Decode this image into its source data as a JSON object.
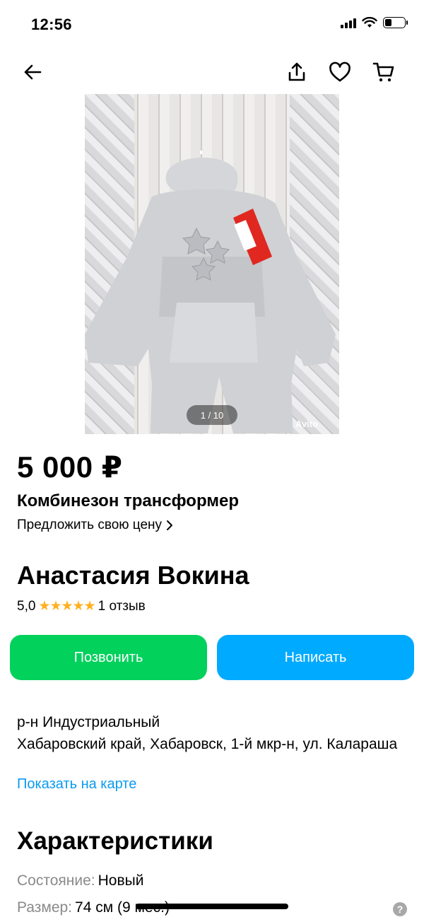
{
  "status_bar": {
    "time": "12:56",
    "battery_level": 0.35
  },
  "nav": {
    "back_icon": "arrow-left-icon",
    "share_icon": "share-icon",
    "favorite_icon": "heart-icon",
    "cart_icon": "cart-icon"
  },
  "gallery": {
    "counter": "1 / 10",
    "watermark": "Avito"
  },
  "listing": {
    "price": "5 000 ₽",
    "title": "Комбинезон трансформер",
    "offer_label": "Предложить свою цену"
  },
  "seller": {
    "name": "Анастасия Вокина",
    "rating": "5,0",
    "stars": "★★★★★",
    "reviews": "1 отзыв"
  },
  "actions": {
    "call_label": "Позвонить",
    "write_label": "Написать"
  },
  "location": {
    "district": "р-н Индустриальный",
    "address": "Хабаровский край, Хабаровск, 1-й мкр-н, ул. Калараша",
    "map_link": "Показать на карте"
  },
  "specs": {
    "title": "Характеристики",
    "items": [
      {
        "key": "Состояние:",
        "value": "Новый"
      },
      {
        "key": "Размер:",
        "value": "74 см (9 мес.)"
      }
    ],
    "help_symbol": "?"
  },
  "colors": {
    "call_button": "#02d15c",
    "write_button": "#00aaff",
    "link": "#0a9bf0",
    "star": "#ffb021"
  }
}
